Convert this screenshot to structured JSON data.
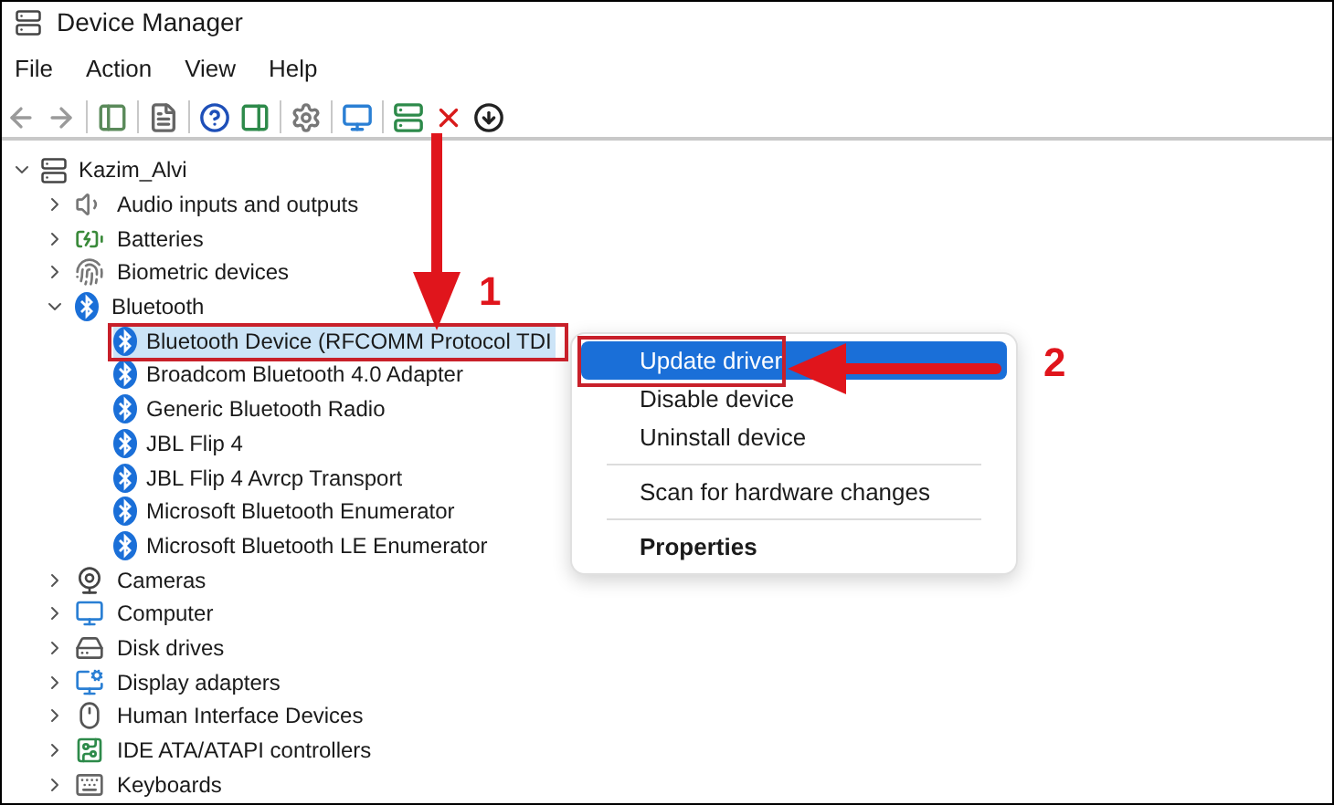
{
  "window": {
    "title": "Device Manager"
  },
  "menu": [
    "File",
    "Action",
    "View",
    "Help"
  ],
  "tree": {
    "label": "Kazim_Alvi",
    "expanded": true,
    "children": [
      {
        "label": "Audio inputs and outputs",
        "expanded": false
      },
      {
        "label": "Batteries",
        "expanded": false
      },
      {
        "label": "Biometric devices",
        "expanded": false
      },
      {
        "label": "Bluetooth",
        "expanded": true,
        "children": [
          {
            "label": "Bluetooth Device (RFCOMM Protocol TDI",
            "selected": true
          },
          {
            "label": "Broadcom Bluetooth 4.0 Adapter",
            "selected": false
          },
          {
            "label": "Generic Bluetooth Radio",
            "selected": false
          },
          {
            "label": "JBL Flip 4",
            "selected": false
          },
          {
            "label": "JBL Flip 4 Avrcp Transport",
            "selected": false
          },
          {
            "label": "Microsoft Bluetooth Enumerator",
            "selected": false
          },
          {
            "label": "Microsoft Bluetooth LE Enumerator",
            "selected": false
          }
        ]
      },
      {
        "label": "Cameras",
        "expanded": false
      },
      {
        "label": "Computer",
        "expanded": false
      },
      {
        "label": "Disk drives",
        "expanded": false
      },
      {
        "label": "Display adapters",
        "expanded": false
      },
      {
        "label": "Human Interface Devices",
        "expanded": false
      },
      {
        "label": "IDE ATA/ATAPI controllers",
        "expanded": false
      },
      {
        "label": "Keyboards",
        "expanded": false
      }
    ]
  },
  "context_menu": {
    "groups": [
      [
        {
          "label": "Update driver",
          "selected": true,
          "kind": "normal"
        },
        {
          "label": "Disable device",
          "selected": false,
          "kind": "normal"
        },
        {
          "label": "Uninstall device",
          "selected": false,
          "kind": "normal"
        }
      ],
      [
        {
          "label": "Scan for hardware changes",
          "selected": false,
          "kind": "normal"
        }
      ],
      [
        {
          "label": "Properties",
          "selected": false,
          "kind": "default"
        }
      ]
    ]
  },
  "annotations": [
    {
      "label": "1"
    },
    {
      "label": "2"
    }
  ]
}
